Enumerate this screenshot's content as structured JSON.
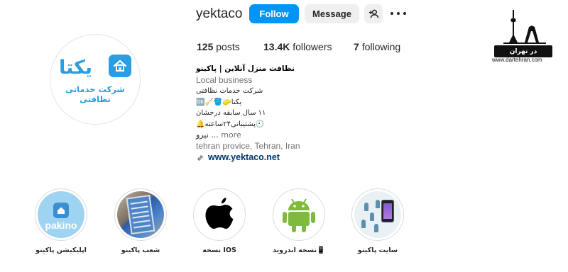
{
  "profile": {
    "username": "yektaco",
    "follow_label": "Follow",
    "message_label": "Message",
    "avatar_logo_word": "یکتا",
    "avatar_logo_tagline": "شرکت خدماتی نظافتی"
  },
  "stats": {
    "posts_count": "125",
    "posts_label": "posts",
    "followers_count": "13.4K",
    "followers_label": "followers",
    "following_count": "7",
    "following_label": "following"
  },
  "bio": {
    "name": "نظافت منزل آنلاین | پاکینو",
    "category": "Local business",
    "line1": "شرکت خدمات نظافتی",
    "line2": "یکتا🧽🪣🧹🆗",
    "line3": "۱۱ سال سابقه درخشان",
    "line4": "🕘پشتیبانی۲۴ساعته🔔",
    "line5": "نیرو ...",
    "more_label": "more",
    "location": "tehran provice, Tehran, Iran",
    "website": "www.yektaco.net"
  },
  "brand": {
    "bar_text": "در تهران",
    "url": "www.dartehran.com"
  },
  "highlights": [
    {
      "label": "اپلیکیشن پاکینو",
      "image_text": "pakino",
      "icon": "pakino-logo-icon"
    },
    {
      "label": "شعب پاکینو",
      "icon": "branch-card-icon"
    },
    {
      "label": "نسخه IOS",
      "icon": "apple-icon"
    },
    {
      "label": "نسخه اندروید📱",
      "icon": "android-icon"
    },
    {
      "label": "سایت پاکینو",
      "icon": "website-network-icon"
    }
  ],
  "colors": {
    "primary_button": "#0095f6",
    "secondary_button": "#efefef",
    "link": "#00376b",
    "logo_blue": "#2a9ee0"
  }
}
